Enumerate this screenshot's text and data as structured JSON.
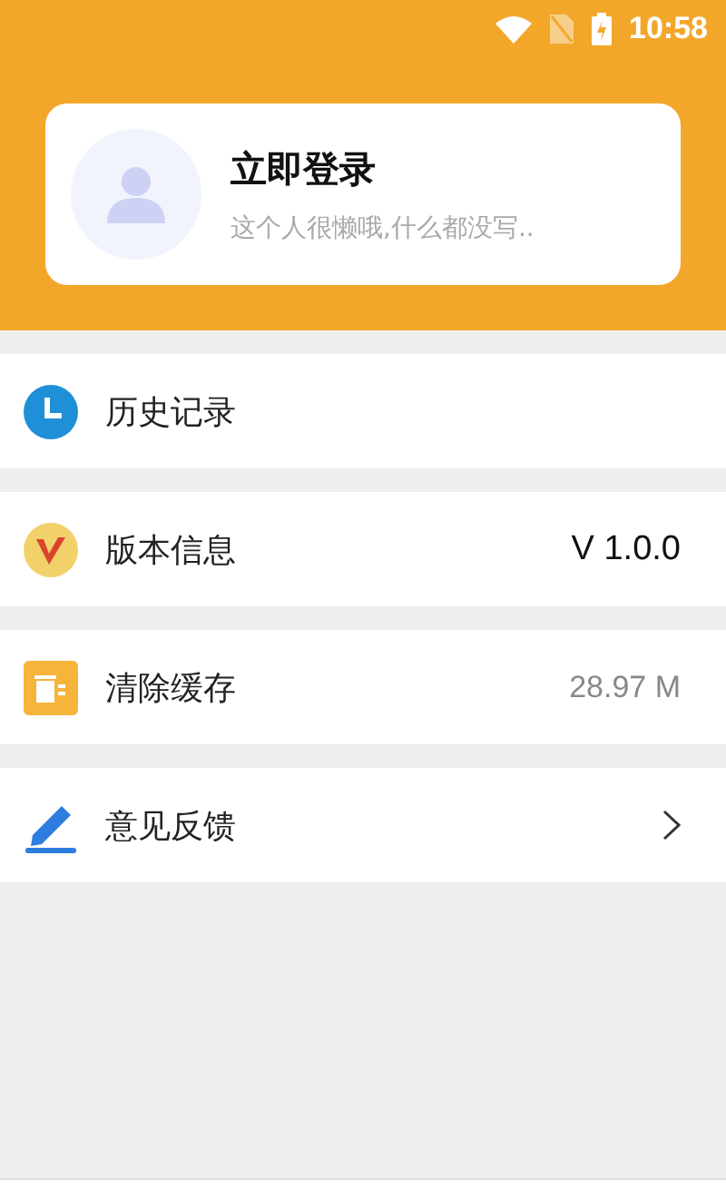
{
  "status_bar": {
    "time": "10:58"
  },
  "profile": {
    "title": "立即登录",
    "subtitle": "这个人很懒哦,什么都没写.."
  },
  "menu": [
    {
      "kind": "plain",
      "label": "历史记录"
    },
    {
      "kind": "version",
      "label": "版本信息",
      "value": "V 1.0.0"
    },
    {
      "kind": "cache",
      "label": "清除缓存",
      "value": "28.97 M"
    },
    {
      "kind": "arrow",
      "label": "意见反馈"
    }
  ]
}
